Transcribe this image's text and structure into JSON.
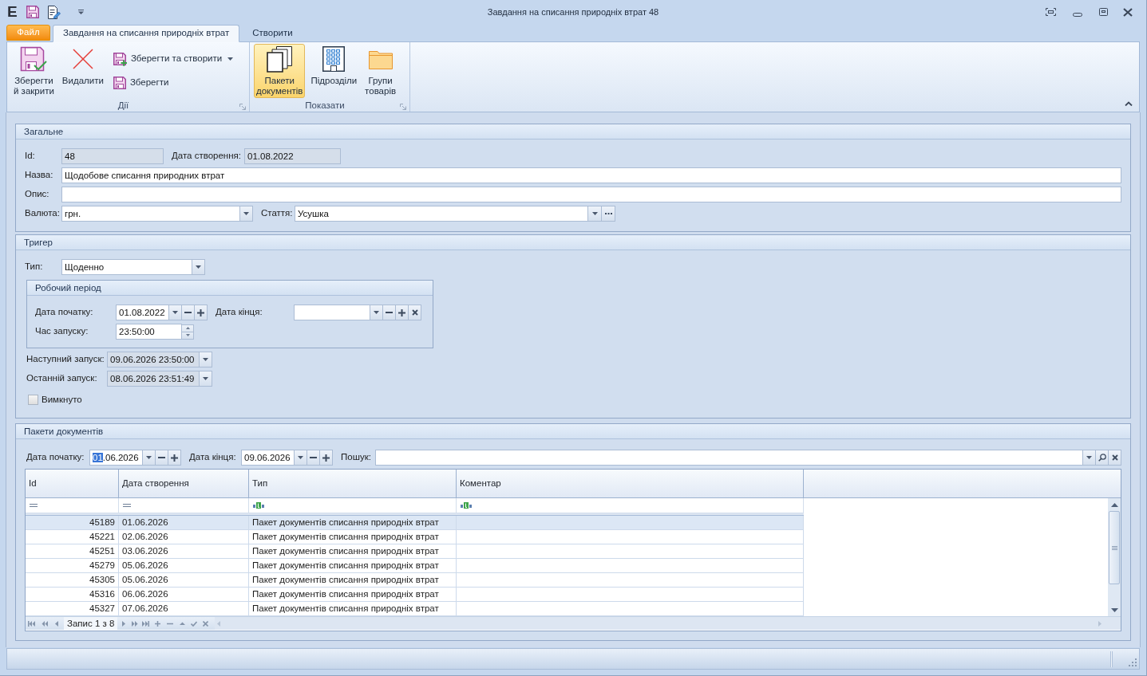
{
  "window": {
    "app_letter": "E",
    "title": "Завдання на списання природніх втрат 48"
  },
  "ribbon": {
    "tabs": [
      {
        "label": "Файл",
        "kind": "file",
        "selected": false
      },
      {
        "label": "Завдання на списання природніх втрат",
        "kind": "page",
        "selected": true
      },
      {
        "label": "Створити",
        "kind": "page",
        "selected": false
      }
    ],
    "groups": [
      {
        "title": "Дії",
        "items": [
          {
            "label": "Зберегти\nй закрити",
            "kind": "large",
            "dropdown": false,
            "selected": false
          },
          {
            "label": "Видалити",
            "kind": "large",
            "dropdown": false,
            "selected": false
          },
          {
            "label": "Зберегти та створити",
            "kind": "small",
            "dropdown": true,
            "selected": false
          },
          {
            "label": "Зберегти",
            "kind": "small",
            "dropdown": false,
            "selected": false
          }
        ]
      },
      {
        "title": "Показати",
        "items": [
          {
            "label": "Пакети\nдокументів",
            "kind": "large",
            "dropdown": false,
            "selected": true
          },
          {
            "label": "Підрозділи",
            "kind": "large",
            "dropdown": false,
            "selected": false
          },
          {
            "label": "Групи\nтоварів",
            "kind": "large",
            "dropdown": false,
            "selected": false
          }
        ]
      }
    ]
  },
  "general": {
    "title": "Загальне",
    "id": {
      "label": "Id:",
      "value": "48",
      "readonly": true
    },
    "created": {
      "label": "Дата створення:",
      "value": "01.08.2022",
      "readonly": true
    },
    "name": {
      "label": "Назва:",
      "value": "Щодобове списання природних втрат",
      "readonly": false
    },
    "description": {
      "label": "Опис:",
      "readonly": false
    },
    "currency": {
      "label": "Валюта:",
      "value": "грн.",
      "readonly": false
    },
    "article": {
      "label": "Стаття:",
      "value": "Усушка",
      "readonly": false
    }
  },
  "trigger": {
    "title": "Тригер",
    "type": {
      "label": "Тип:",
      "value": "Щоденно",
      "readonly": false
    },
    "period": {
      "title": "Робочий період",
      "start": {
        "label": "Дата початку:",
        "value": "01.08.2022",
        "readonly": false
      },
      "end": {
        "label": "Дата кінця:",
        "readonly": false
      },
      "time": {
        "label": "Час запуску:",
        "value": "23:50:00",
        "readonly": false
      }
    },
    "next_run": {
      "label": "Наступний запуск:",
      "value": "09.06.2026 23:50:00",
      "readonly": true
    },
    "last_run": {
      "label": "Останній запуск:",
      "value": "08.06.2026 23:51:49",
      "readonly": true
    },
    "off": {
      "label": "Вимкнуто",
      "checked": false
    }
  },
  "packages": {
    "title": "Пакети документів",
    "start": {
      "label": "Дата початку:",
      "value": [
        {
          "text": "01",
          "selected": true
        },
        {
          "text": ".06.2026",
          "selected": false
        }
      ]
    },
    "end": {
      "label": "Дата кінця:",
      "value": [
        {
          "text": "09.06.2026",
          "selected": false
        }
      ]
    },
    "search": {
      "label": "Пошук:"
    },
    "table": {
      "columns": [
        {
          "label": "Id",
          "kind": "number"
        },
        {
          "label": "Дата створення",
          "kind": "date"
        },
        {
          "label": "Тип",
          "kind": "text"
        },
        {
          "label": "Коментар",
          "kind": "text"
        }
      ],
      "rows": [
        {
          "cells": [
            "45189",
            "01.06.2026",
            "Пакет документів списання природніх втрат"
          ],
          "selected": true
        },
        {
          "cells": [
            "45221",
            "02.06.2026",
            "Пакет документів списання природніх втрат"
          ],
          "selected": false
        },
        {
          "cells": [
            "45251",
            "03.06.2026",
            "Пакет документів списання природніх втрат"
          ],
          "selected": false
        },
        {
          "cells": [
            "45279",
            "05.06.2026",
            "Пакет документів списання природніх втрат"
          ],
          "selected": false
        },
        {
          "cells": [
            "45305",
            "05.06.2026",
            "Пакет документів списання природніх втрат"
          ],
          "selected": false
        },
        {
          "cells": [
            "45316",
            "06.06.2026",
            "Пакет документів списання природніх втрат"
          ],
          "selected": false
        },
        {
          "cells": [
            "45327",
            "07.06.2026",
            "Пакет документів списання природніх втрат"
          ],
          "selected": false
        }
      ]
    },
    "navigator": {
      "record": "Запис 1 з 8"
    }
  }
}
